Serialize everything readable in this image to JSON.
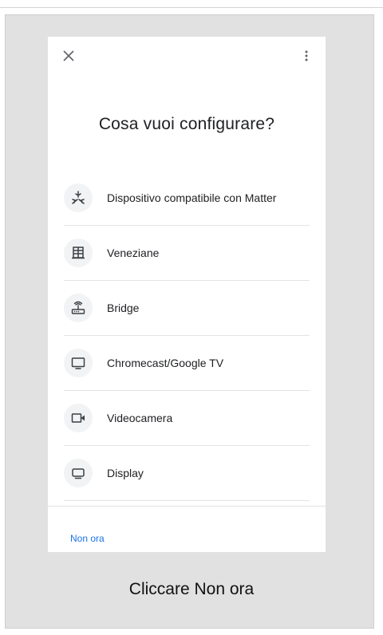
{
  "dialog": {
    "close_icon": "close-icon",
    "menu_icon": "more-vert-icon",
    "title": "Cosa vuoi configurare?",
    "items": [
      {
        "label": "Dispositivo compatibile con Matter",
        "icon": "matter-icon"
      },
      {
        "label": "Veneziane",
        "icon": "blinds-icon"
      },
      {
        "label": "Bridge",
        "icon": "router-icon"
      },
      {
        "label": "Chromecast/Google TV",
        "icon": "tv-icon"
      },
      {
        "label": "Videocamera",
        "icon": "videocam-icon"
      },
      {
        "label": "Display",
        "icon": "display-icon"
      }
    ],
    "secondary_action": "Non ora"
  },
  "caption": "Cliccare Non ora",
  "colors": {
    "accent": "#1a73e8",
    "text": "#202124",
    "icon_bg": "#f1f3f4",
    "frame_bg": "#e1e1e1"
  }
}
